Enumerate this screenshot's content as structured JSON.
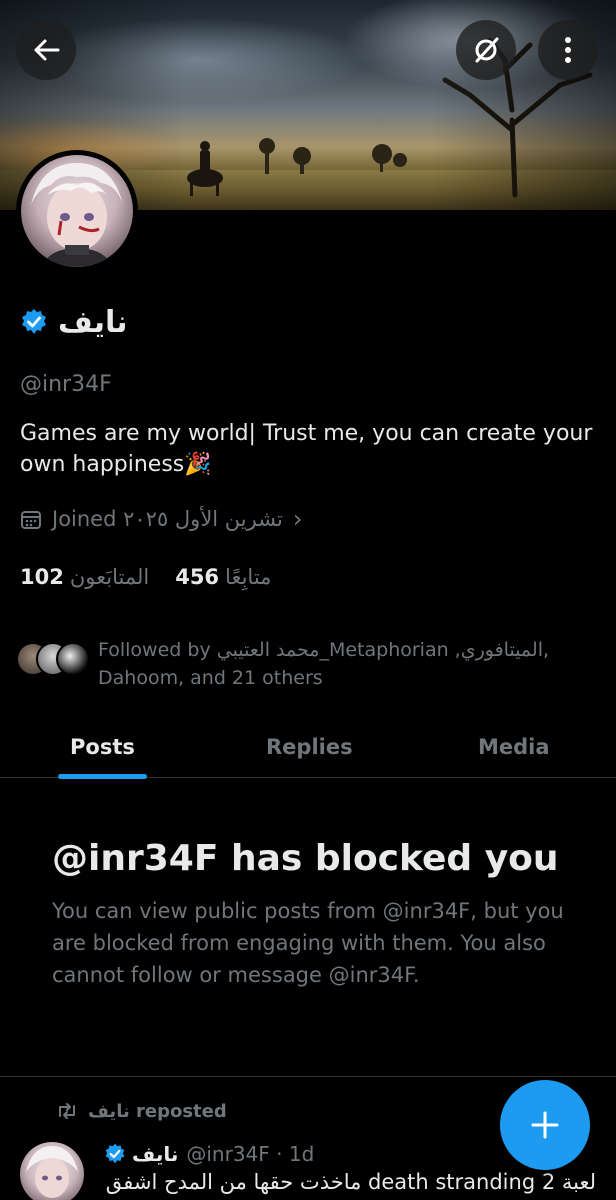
{
  "header": {
    "back_icon": "arrow-left-icon",
    "grok_icon": "grok-icon",
    "more_icon": "more-vertical-icon"
  },
  "profile": {
    "display_name": "نايف",
    "verified": true,
    "handle": "@inr34F",
    "bio": "Games are my world| Trust me, you can create your own happiness🎉",
    "joined": "Joined تشرين الأول ٢٠٢٥",
    "following_count": "456",
    "following_label": "متابِعًا",
    "followers_count": "102",
    "followers_label": "المتابَعون",
    "followed_by": "Followed by محمد العتيبي_Metaphorian ,الميتافوري, Dahoom, and 21 others"
  },
  "tabs": [
    {
      "label": "Posts",
      "active": true
    },
    {
      "label": "Replies",
      "active": false
    },
    {
      "label": "Media",
      "active": false
    }
  ],
  "blocked": {
    "title": "@inr34F has blocked you",
    "body": "You can view public posts from @inr34F, but you are blocked from engaging with them. You also cannot follow or message @inr34F."
  },
  "post": {
    "repost_label": "نايف reposted",
    "author_name": "نايف",
    "author_handle": "@inr34F · 1d",
    "text": "لعبة death stranding 2 ماخذت حقها من المدح اشفق"
  },
  "fab_icon": "plus-icon",
  "colors": {
    "accent": "#1d9bf0",
    "background": "#000000",
    "text_primary": "#e7e9ea",
    "text_secondary": "#71767b"
  }
}
